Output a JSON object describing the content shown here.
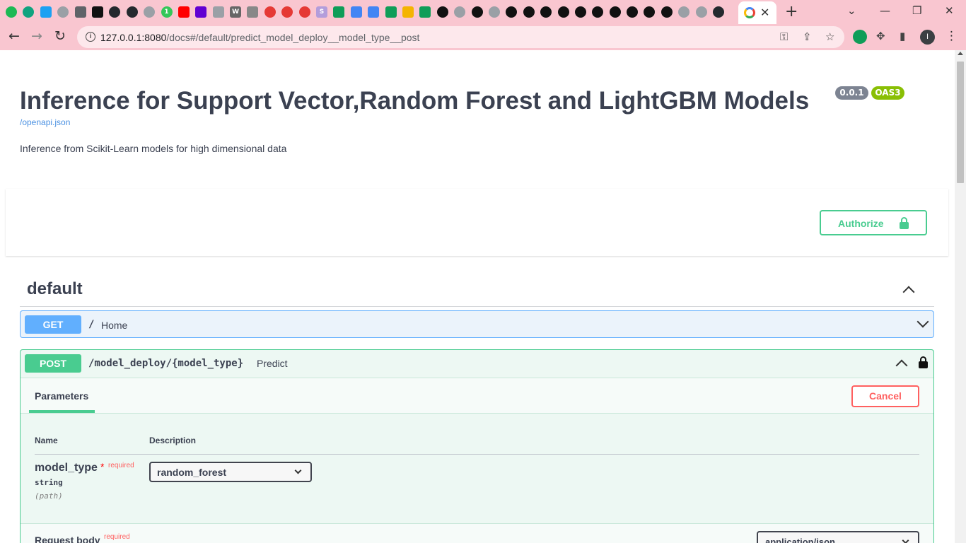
{
  "browser": {
    "url_host": "127.0.0.1:8080",
    "url_path": "/docs#/default/predict_model_deploy__model_type__post",
    "profile_initial": "I",
    "tab_favicons": [
      {
        "icon": "spotify-icon",
        "color": "#1db954",
        "glyph": "",
        "round": true
      },
      {
        "icon": "chatgpt-icon",
        "color": "#10a37f",
        "glyph": "",
        "round": true
      },
      {
        "icon": "twitter-icon",
        "color": "#1da1f2",
        "glyph": "",
        "round": false
      },
      {
        "icon": "globe-icon",
        "color": "#9aa0a6",
        "glyph": "",
        "round": true
      },
      {
        "icon": "mountain-icon",
        "color": "#5f6368",
        "glyph": "",
        "round": false
      },
      {
        "icon": "terminal-icon",
        "color": "#111111",
        "glyph": "",
        "round": false
      },
      {
        "icon": "github-icon",
        "color": "#24292e",
        "glyph": "",
        "round": true
      },
      {
        "icon": "github-icon",
        "color": "#24292e",
        "glyph": "",
        "round": true
      },
      {
        "icon": "globe-icon",
        "color": "#9aa0a6",
        "glyph": "",
        "round": true
      },
      {
        "icon": "one-icon",
        "color": "#34c759",
        "glyph": "1",
        "round": true
      },
      {
        "icon": "youtube-icon",
        "color": "#ff0000",
        "glyph": "",
        "round": false
      },
      {
        "icon": "mail-icon",
        "color": "#6001d2",
        "glyph": "",
        "round": false
      },
      {
        "icon": "box-icon",
        "color": "#9aa0a6",
        "glyph": "",
        "round": false
      },
      {
        "icon": "w-icon",
        "color": "#666666",
        "glyph": "W",
        "round": false
      },
      {
        "icon": "alpha-icon",
        "color": "#888888",
        "glyph": "",
        "round": false
      },
      {
        "icon": "circle-icon",
        "color": "#e53935",
        "glyph": "",
        "round": true
      },
      {
        "icon": "circle-icon",
        "color": "#e53935",
        "glyph": "",
        "round": true
      },
      {
        "icon": "circle-icon",
        "color": "#e53935",
        "glyph": "",
        "round": true
      },
      {
        "icon": "s-icon",
        "color": "#b39ddb",
        "glyph": "S",
        "round": false
      },
      {
        "icon": "sheets-icon",
        "color": "#0f9d58",
        "glyph": "",
        "round": false
      },
      {
        "icon": "docs-icon",
        "color": "#4285f4",
        "glyph": "",
        "round": false
      },
      {
        "icon": "docs-icon",
        "color": "#4285f4",
        "glyph": "",
        "round": false
      },
      {
        "icon": "sheets-icon",
        "color": "#0f9d58",
        "glyph": "",
        "round": false
      },
      {
        "icon": "slides-icon",
        "color": "#f4b400",
        "glyph": "",
        "round": false
      },
      {
        "icon": "sheets-icon",
        "color": "#0f9d58",
        "glyph": "",
        "round": false
      },
      {
        "icon": "bolt-icon",
        "color": "#111111",
        "glyph": "",
        "round": true
      },
      {
        "icon": "globe-icon",
        "color": "#9aa0a6",
        "glyph": "",
        "round": true
      },
      {
        "icon": "bolt-icon",
        "color": "#111111",
        "glyph": "",
        "round": true
      },
      {
        "icon": "globe-icon",
        "color": "#9aa0a6",
        "glyph": "",
        "round": true
      },
      {
        "icon": "bolt-icon",
        "color": "#111111",
        "glyph": "",
        "round": true
      },
      {
        "icon": "bolt-icon",
        "color": "#111111",
        "glyph": "",
        "round": true
      },
      {
        "icon": "bolt-icon",
        "color": "#111111",
        "glyph": "",
        "round": true
      },
      {
        "icon": "bolt-icon",
        "color": "#111111",
        "glyph": "",
        "round": true
      },
      {
        "icon": "bolt-icon",
        "color": "#111111",
        "glyph": "",
        "round": true
      },
      {
        "icon": "bolt-icon",
        "color": "#111111",
        "glyph": "",
        "round": true
      },
      {
        "icon": "bolt-icon",
        "color": "#111111",
        "glyph": "",
        "round": true
      },
      {
        "icon": "bolt-icon",
        "color": "#111111",
        "glyph": "",
        "round": true
      },
      {
        "icon": "bolt-icon",
        "color": "#111111",
        "glyph": "",
        "round": true
      },
      {
        "icon": "bolt-icon",
        "color": "#111111",
        "glyph": "",
        "round": true
      },
      {
        "icon": "globe-icon",
        "color": "#9aa0a6",
        "glyph": "",
        "round": true
      },
      {
        "icon": "globe-icon",
        "color": "#9aa0a6",
        "glyph": "",
        "round": true
      },
      {
        "icon": "github-icon",
        "color": "#24292e",
        "glyph": "",
        "round": true
      }
    ]
  },
  "header": {
    "title": "Inference for Support Vector,Random Forest and LightGBM Models",
    "version_badge": "0.0.1",
    "oas_badge": "OAS3",
    "openapi_link": "/openapi.json",
    "description": "Inference from Scikit-Learn models for high dimensional data",
    "authorize_label": "Authorize"
  },
  "tag": {
    "name": "default"
  },
  "operations": {
    "get": {
      "method": "GET",
      "path": "/",
      "summary": "Home"
    },
    "post": {
      "method": "POST",
      "path": "/model_deploy/{model_type}",
      "summary": "Predict",
      "tab_label": "Parameters",
      "cancel_label": "Cancel",
      "col_name": "Name",
      "col_description": "Description",
      "param": {
        "name": "model_type",
        "star": "*",
        "required": "required",
        "type": "string",
        "in": "(path)",
        "selected": "random_forest"
      },
      "request_body": {
        "title": "Request body",
        "required": "required",
        "content_type": "application/json"
      }
    }
  },
  "colors": {
    "get": "#61affe",
    "post": "#49cc90",
    "cancel": "#ff6060",
    "chrome": "#f9c6d0"
  }
}
